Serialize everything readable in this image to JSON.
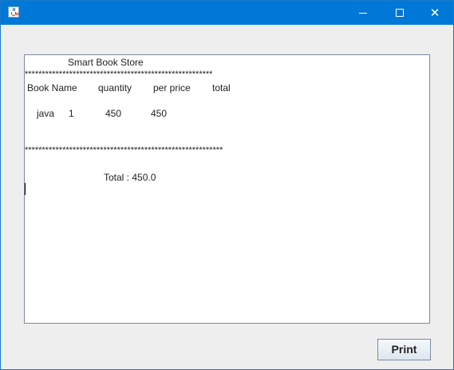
{
  "window": {
    "icon": "java-cup-icon",
    "controls": {
      "minimize": "minimize-icon",
      "maximize": "maximize-icon",
      "close": "close-icon",
      "close_glyph": "✕"
    }
  },
  "receipt": {
    "store_name": "Smart Book Store",
    "separator_top": "*******************************************************",
    "headers": {
      "book_name": "Book Name",
      "quantity": "quantity",
      "per_price": "per price",
      "total": "total"
    },
    "row": {
      "book_name": "java",
      "quantity": "1",
      "per_price": "450",
      "total": "450"
    },
    "separator_bottom": "**********************************************************",
    "grand_total": "Total : 450.0"
  },
  "actions": {
    "print_label": "Print"
  }
}
